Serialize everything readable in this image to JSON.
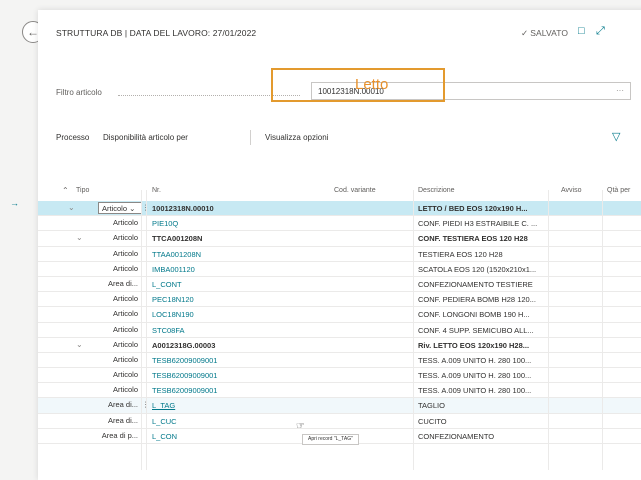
{
  "header": {
    "title": "STRUTTURA DB | DATA DEL LAVORO: 27/01/2022",
    "saved_check": "✓",
    "saved": "SALVATO"
  },
  "filter": {
    "label": "Filtro articolo",
    "value": "10012318N.00010",
    "more": "···",
    "annotation": "Letto"
  },
  "actions": {
    "processo": "Processo",
    "disponibilita": "Disponibilità articolo per",
    "visualizza": "Visualizza opzioni"
  },
  "columns": {
    "tipo": "Tipo",
    "nr": "Nr.",
    "cod_variante": "Cod. variante",
    "descrizione": "Descrizione",
    "avviso": "Avviso",
    "qta": "Qtà per"
  },
  "rows": [
    {
      "tipo": "Articolo",
      "nr": "10012318N.00010",
      "desc": "LETTO / BED EOS 120x190 H..."
    },
    {
      "tipo": "Articolo",
      "nr": "PIE10Q",
      "desc": "CONF. PIEDI H3 ESTRAIBILE C. ..."
    },
    {
      "tipo": "Articolo",
      "nr": "TTCA001208N",
      "desc": "CONF. TESTIERA EOS 120 H28"
    },
    {
      "tipo": "Articolo",
      "nr": "TTAA001208N",
      "desc": "TESTIERA EOS 120 H28"
    },
    {
      "tipo": "Articolo",
      "nr": "IMBA001120",
      "desc": "SCATOLA EOS 120 (1520x210x1..."
    },
    {
      "tipo": "Area di...",
      "nr": "L_CONT",
      "desc": "CONFEZIONAMENTO TESTIERE"
    },
    {
      "tipo": "Articolo",
      "nr": "PEC18N120",
      "desc": "CONF. PEDIERA BOMB H28 120..."
    },
    {
      "tipo": "Articolo",
      "nr": "LOC18N190",
      "desc": "CONF. LONGONI BOMB 190 H..."
    },
    {
      "tipo": "Articolo",
      "nr": "STC08FA",
      "desc": "CONF. 4 SUPP. SEMICUBO ALL..."
    },
    {
      "tipo": "Articolo",
      "nr": "A0012318G.00003",
      "desc": "Riv. LETTO EOS 120x190 H28..."
    },
    {
      "tipo": "Articolo",
      "nr": "TESB62009009001",
      "desc": "TESS. A.009 UNITO H. 280 100..."
    },
    {
      "tipo": "Articolo",
      "nr": "TESB62009009001",
      "desc": "TESS. A.009 UNITO H. 280 100..."
    },
    {
      "tipo": "Articolo",
      "nr": "TESB62009009001",
      "desc": "TESS. A.009 UNITO H. 280 100..."
    },
    {
      "tipo": "Area di...",
      "nr": "L_TAG",
      "desc": "TAGLIO"
    },
    {
      "tipo": "Area di...",
      "nr": "L_CUC",
      "desc": "CUCITO"
    },
    {
      "tipo": "Area di p...",
      "nr": "L_CON",
      "desc": "CONFEZIONAMENTO"
    }
  ],
  "tooltip": "Apri record \"L_TAG\""
}
